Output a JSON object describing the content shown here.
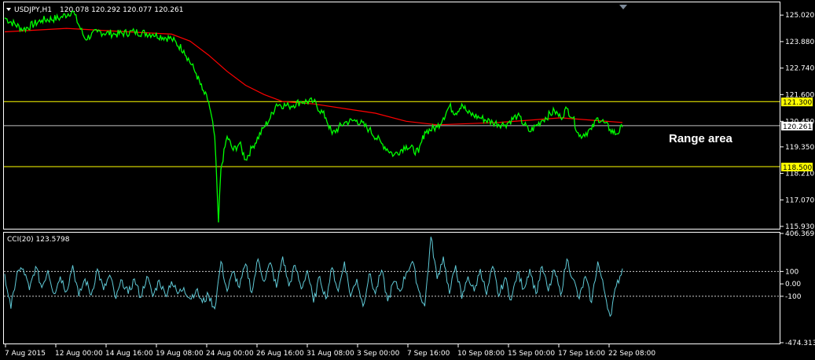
{
  "header": {
    "symbol": "USDJPY,H1",
    "ohlc": "120.078 120.292 120.077 120.261"
  },
  "colors": {
    "background": "#000000",
    "price": "#00ff00",
    "ma": "#ff0000",
    "level": "#ffff00",
    "current": "#c0c0c0",
    "cci": "#5fc9d6",
    "frame": "#ffffff"
  },
  "chart_data": [
    {
      "type": "line",
      "name": "price-pane",
      "title": "USDJPY,H1",
      "ylim": [
        115.93,
        125.5
      ],
      "y_ticks": [
        "125.020",
        "123.880",
        "122.740",
        "121.600",
        "120.450",
        "119.350",
        "118.210",
        "117.070",
        "115.930"
      ],
      "x_ticks": [
        "7 Aug 2015",
        "12 Aug 00:00",
        "14 Aug 16:00",
        "19 Aug 08:00",
        "24 Aug 00:00",
        "26 Aug 16:00",
        "31 Aug 08:00",
        "3 Sep 00:00",
        "7 Sep 16:00",
        "10 Sep 08:00",
        "15 Sep 00:00",
        "17 Sep 16:00",
        "22 Sep 08:00"
      ],
      "price_series": [
        {
          "x": 0,
          "y": 124.9
        },
        {
          "x": 3,
          "y": 124.4
        },
        {
          "x": 6,
          "y": 124.8
        },
        {
          "x": 9,
          "y": 124.9
        },
        {
          "x": 11,
          "y": 125.2
        },
        {
          "x": 13,
          "y": 124.0
        },
        {
          "x": 15,
          "y": 124.3
        },
        {
          "x": 18,
          "y": 124.2
        },
        {
          "x": 21,
          "y": 124.3
        },
        {
          "x": 24,
          "y": 124.2
        },
        {
          "x": 27,
          "y": 124.0
        },
        {
          "x": 29,
          "y": 123.5
        },
        {
          "x": 31,
          "y": 122.5
        },
        {
          "x": 32,
          "y": 121.8
        },
        {
          "x": 33,
          "y": 121.3
        },
        {
          "x": 34,
          "y": 119.8
        },
        {
          "x": 34.6,
          "y": 116.1
        },
        {
          "x": 35,
          "y": 118.4
        },
        {
          "x": 36,
          "y": 119.8
        },
        {
          "x": 37,
          "y": 119.2
        },
        {
          "x": 38,
          "y": 119.5
        },
        {
          "x": 39,
          "y": 118.8
        },
        {
          "x": 40,
          "y": 119.3
        },
        {
          "x": 42,
          "y": 120.2
        },
        {
          "x": 43,
          "y": 120.6
        },
        {
          "x": 44,
          "y": 121.2
        },
        {
          "x": 46,
          "y": 121.1
        },
        {
          "x": 48,
          "y": 121.3
        },
        {
          "x": 50,
          "y": 121.3
        },
        {
          "x": 52,
          "y": 120.6
        },
        {
          "x": 53,
          "y": 119.9
        },
        {
          "x": 55,
          "y": 120.4
        },
        {
          "x": 57,
          "y": 120.5
        },
        {
          "x": 59,
          "y": 120.1
        },
        {
          "x": 61,
          "y": 119.5
        },
        {
          "x": 63,
          "y": 119.0
        },
        {
          "x": 65,
          "y": 119.4
        },
        {
          "x": 67,
          "y": 119.1
        },
        {
          "x": 68,
          "y": 120.0
        },
        {
          "x": 70,
          "y": 120.2
        },
        {
          "x": 71,
          "y": 120.6
        },
        {
          "x": 72,
          "y": 121.1
        },
        {
          "x": 73,
          "y": 120.8
        },
        {
          "x": 74,
          "y": 121.2
        },
        {
          "x": 75,
          "y": 120.8
        },
        {
          "x": 77,
          "y": 120.6
        },
        {
          "x": 79,
          "y": 120.4
        },
        {
          "x": 81,
          "y": 120.3
        },
        {
          "x": 83,
          "y": 120.7
        },
        {
          "x": 85,
          "y": 120.0
        },
        {
          "x": 87,
          "y": 120.5
        },
        {
          "x": 89,
          "y": 120.9
        },
        {
          "x": 90,
          "y": 120.6
        },
        {
          "x": 91,
          "y": 121.0
        },
        {
          "x": 92,
          "y": 120.6
        },
        {
          "x": 93,
          "y": 119.8
        },
        {
          "x": 95,
          "y": 120.1
        },
        {
          "x": 96,
          "y": 120.6
        },
        {
          "x": 97,
          "y": 120.4
        },
        {
          "x": 98,
          "y": 120.1
        },
        {
          "x": 99,
          "y": 119.9
        },
        {
          "x": 100,
          "y": 120.2
        }
      ],
      "ma_series": [
        {
          "x": 0,
          "y": 124.3
        },
        {
          "x": 10,
          "y": 124.45
        },
        {
          "x": 20,
          "y": 124.3
        },
        {
          "x": 27,
          "y": 124.2
        },
        {
          "x": 30,
          "y": 123.9
        },
        {
          "x": 33,
          "y": 123.3
        },
        {
          "x": 36,
          "y": 122.6
        },
        {
          "x": 39,
          "y": 122.0
        },
        {
          "x": 42,
          "y": 121.6
        },
        {
          "x": 45,
          "y": 121.3
        },
        {
          "x": 50,
          "y": 121.2
        },
        {
          "x": 55,
          "y": 121.0
        },
        {
          "x": 60,
          "y": 120.8
        },
        {
          "x": 65,
          "y": 120.45
        },
        {
          "x": 70,
          "y": 120.3
        },
        {
          "x": 75,
          "y": 120.35
        },
        {
          "x": 80,
          "y": 120.4
        },
        {
          "x": 85,
          "y": 120.5
        },
        {
          "x": 90,
          "y": 120.6
        },
        {
          "x": 95,
          "y": 120.5
        },
        {
          "x": 100,
          "y": 120.4
        }
      ],
      "levels": [
        {
          "label": "121.300",
          "value": 121.3
        },
        {
          "label": "118.500",
          "value": 118.5
        }
      ],
      "current_price": {
        "label": "120.261",
        "value": 120.261
      },
      "annotation": "Range area"
    },
    {
      "type": "line",
      "name": "cci-pane",
      "title": "CCI(20) 123.5798",
      "ylim": [
        -474.3136,
        406.3691
      ],
      "y_ticks": [
        "406.3691",
        "100",
        "0.00",
        "-100",
        "-474.3136"
      ],
      "levels": [
        100,
        -100
      ],
      "series": [
        {
          "x": 0,
          "y": 80
        },
        {
          "x": 1,
          "y": -200
        },
        {
          "x": 2,
          "y": 90
        },
        {
          "x": 3,
          "y": 120
        },
        {
          "x": 4,
          "y": -50
        },
        {
          "x": 5,
          "y": 140
        },
        {
          "x": 6,
          "y": -30
        },
        {
          "x": 7,
          "y": 110
        },
        {
          "x": 8,
          "y": -80
        },
        {
          "x": 9,
          "y": 60
        },
        {
          "x": 10,
          "y": -60
        },
        {
          "x": 11,
          "y": 150
        },
        {
          "x": 12,
          "y": -100
        },
        {
          "x": 13,
          "y": 40
        },
        {
          "x": 14,
          "y": -90
        },
        {
          "x": 15,
          "y": 120
        },
        {
          "x": 16,
          "y": -50
        },
        {
          "x": 17,
          "y": 70
        },
        {
          "x": 18,
          "y": -120
        },
        {
          "x": 19,
          "y": 30
        },
        {
          "x": 20,
          "y": -80
        },
        {
          "x": 21,
          "y": 40
        },
        {
          "x": 22,
          "y": -110
        },
        {
          "x": 23,
          "y": 60
        },
        {
          "x": 24,
          "y": -100
        },
        {
          "x": 25,
          "y": 30
        },
        {
          "x": 26,
          "y": -90
        },
        {
          "x": 27,
          "y": 20
        },
        {
          "x": 28,
          "y": -80
        },
        {
          "x": 29,
          "y": -30
        },
        {
          "x": 30,
          "y": -120
        },
        {
          "x": 31,
          "y": -50
        },
        {
          "x": 32,
          "y": -150
        },
        {
          "x": 33,
          "y": -90
        },
        {
          "x": 34,
          "y": -200
        },
        {
          "x": 35,
          "y": 180
        },
        {
          "x": 36,
          "y": -60
        },
        {
          "x": 37,
          "y": 100
        },
        {
          "x": 38,
          "y": -30
        },
        {
          "x": 39,
          "y": 160
        },
        {
          "x": 40,
          "y": -70
        },
        {
          "x": 41,
          "y": 200
        },
        {
          "x": 42,
          "y": 20
        },
        {
          "x": 43,
          "y": 170
        },
        {
          "x": 44,
          "y": -30
        },
        {
          "x": 45,
          "y": 220
        },
        {
          "x": 46,
          "y": -20
        },
        {
          "x": 47,
          "y": 150
        },
        {
          "x": 48,
          "y": -40
        },
        {
          "x": 49,
          "y": 110
        },
        {
          "x": 50,
          "y": -150
        },
        {
          "x": 51,
          "y": 60
        },
        {
          "x": 52,
          "y": -120
        },
        {
          "x": 53,
          "y": 130
        },
        {
          "x": 54,
          "y": -60
        },
        {
          "x": 55,
          "y": 180
        },
        {
          "x": 56,
          "y": -100
        },
        {
          "x": 57,
          "y": 40
        },
        {
          "x": 58,
          "y": -180
        },
        {
          "x": 59,
          "y": 80
        },
        {
          "x": 60,
          "y": -80
        },
        {
          "x": 61,
          "y": 110
        },
        {
          "x": 62,
          "y": -140
        },
        {
          "x": 63,
          "y": 20
        },
        {
          "x": 64,
          "y": -60
        },
        {
          "x": 65,
          "y": 90
        },
        {
          "x": 66,
          "y": 180
        },
        {
          "x": 67,
          "y": -50
        },
        {
          "x": 68,
          "y": -180
        },
        {
          "x": 69,
          "y": 380
        },
        {
          "x": 70,
          "y": 40
        },
        {
          "x": 71,
          "y": 220
        },
        {
          "x": 72,
          "y": -80
        },
        {
          "x": 73,
          "y": 150
        },
        {
          "x": 74,
          "y": -120
        },
        {
          "x": 75,
          "y": 60
        },
        {
          "x": 76,
          "y": -60
        },
        {
          "x": 77,
          "y": 120
        },
        {
          "x": 78,
          "y": -90
        },
        {
          "x": 79,
          "y": 140
        },
        {
          "x": 80,
          "y": -100
        },
        {
          "x": 81,
          "y": 50
        },
        {
          "x": 82,
          "y": -130
        },
        {
          "x": 83,
          "y": 90
        },
        {
          "x": 84,
          "y": -40
        },
        {
          "x": 85,
          "y": 120
        },
        {
          "x": 86,
          "y": -80
        },
        {
          "x": 87,
          "y": 140
        },
        {
          "x": 88,
          "y": -60
        },
        {
          "x": 89,
          "y": 110
        },
        {
          "x": 90,
          "y": -90
        },
        {
          "x": 91,
          "y": 200
        },
        {
          "x": 92,
          "y": 40
        },
        {
          "x": 93,
          "y": -120
        },
        {
          "x": 94,
          "y": 60
        },
        {
          "x": 95,
          "y": -150
        },
        {
          "x": 96,
          "y": 180
        },
        {
          "x": 97,
          "y": -40
        },
        {
          "x": 98,
          "y": -260
        },
        {
          "x": 99,
          "y": -20
        },
        {
          "x": 100,
          "y": 124
        }
      ]
    }
  ]
}
